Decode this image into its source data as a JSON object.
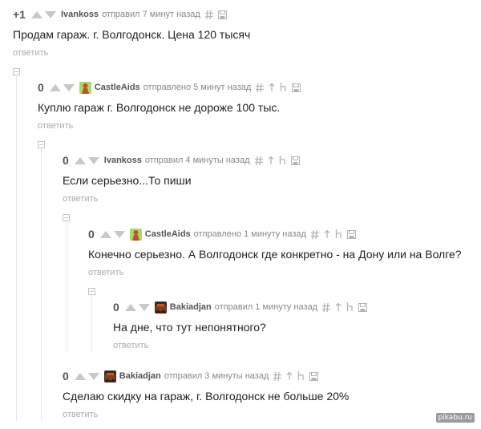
{
  "comments": [
    {
      "rating": "+1",
      "author": "Ivankoss",
      "action": "отправил",
      "time": "7 минут назад",
      "text": "Продам гараж. г. Волгодонск. Цена 120 тысяч",
      "reply_label": "ответить",
      "has_avatar": false,
      "icons": [
        "hash-icon",
        "save-icon"
      ]
    },
    {
      "rating": "0",
      "author": "CastleAids",
      "action": "отправлено",
      "time": "5 минут назад",
      "text": "Куплю гараж г. Волгодонск не дороже 100 тыс.",
      "reply_label": "ответить",
      "has_avatar": true,
      "avatar_color": "#6bbf2f",
      "icons": [
        "hash-icon",
        "parent-icon",
        "thread-icon",
        "save-icon"
      ]
    },
    {
      "rating": "0",
      "author": "Ivankoss",
      "action": "отправил",
      "time": "4 минуты назад",
      "text": "Если серьезно...То пиши",
      "reply_label": "ответить",
      "has_avatar": false,
      "icons": [
        "hash-icon",
        "parent-icon",
        "thread-icon",
        "save-icon"
      ]
    },
    {
      "rating": "0",
      "author": "CastleAids",
      "action": "отправлено",
      "time": "1 минуту назад",
      "text": "Конечно серьезно. А Волгодонск где конкретно - на Дону или на Волге?",
      "reply_label": "ответить",
      "has_avatar": true,
      "avatar_color": "#6bbf2f",
      "icons": [
        "hash-icon",
        "parent-icon",
        "thread-icon",
        "save-icon"
      ]
    },
    {
      "rating": "0",
      "author": "Bakiadjan",
      "action": "отправил",
      "time": "1 минуту назад",
      "text": "На дне, что тут непонятного?",
      "reply_label": "ответить",
      "has_avatar": true,
      "avatar_color": "#7a3a1a",
      "icons": [
        "hash-icon",
        "parent-icon",
        "thread-icon",
        "save-icon"
      ]
    },
    {
      "rating": "0",
      "author": "Bakiadjan",
      "action": "отправил",
      "time": "3 минуты назад",
      "text": "Сделаю скидку на гараж, г. Волгодонск не больше 20%",
      "reply_label": "ответить",
      "has_avatar": true,
      "avatar_color": "#7a3a1a",
      "icons": [
        "hash-icon",
        "parent-icon",
        "thread-icon",
        "save-icon"
      ]
    }
  ],
  "watermark": "pikabu.ru",
  "colors": {
    "text": "#222222",
    "meta": "#888888",
    "reply": "#aaaaaa",
    "vote_arrow": "#c8c8c8",
    "icon": "#b4b4b4",
    "tree_line": "#e6e6e6"
  }
}
